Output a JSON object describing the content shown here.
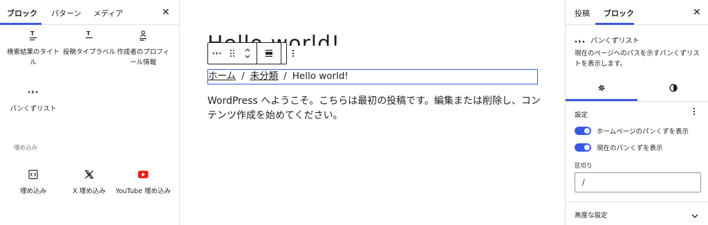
{
  "inserter": {
    "tabs": [
      "ブロック",
      "パターン",
      "メディア"
    ],
    "blocks": [
      {
        "label": "検索結果のタイトル",
        "icon": "title-icon"
      },
      {
        "label": "投稿タイプラベル",
        "icon": "post-type-label-icon"
      },
      {
        "label": "作成者のプロフィール情報",
        "icon": "author-biography-icon"
      },
      {
        "label": "パンくずリスト",
        "icon": "breadcrumbs-icon"
      }
    ],
    "embed_section_title": "埋め込み",
    "embeds": [
      {
        "label": "埋め込み",
        "icon": "embed-icon"
      },
      {
        "label": "X 埋め込み",
        "icon": "x-logo-icon"
      },
      {
        "label": "YouTube 埋め込み",
        "icon": "youtube-icon"
      }
    ]
  },
  "canvas": {
    "ghost_title": "Hello world!",
    "breadcrumbs": [
      {
        "text": "ホーム",
        "link": true
      },
      {
        "text": "未分類",
        "link": true
      },
      {
        "text": "Hello world!",
        "link": false
      }
    ],
    "separator": "/",
    "paragraph": "WordPress へようこそ。こちらは最初の投稿です。編集または削除し、コンテンツ作成を始めてください。"
  },
  "sidebar": {
    "tabs": [
      "投稿",
      "ブロック"
    ],
    "block_name": "パンくずリスト",
    "block_description": "現在のページへのパスを示すパンくずリストを表示します。",
    "settings_title": "設定",
    "toggles": [
      {
        "label": "ホームページのパンくずを表示",
        "on": true
      },
      {
        "label": "現在のパンくずを表示",
        "on": true
      }
    ],
    "separator_label": "区切り",
    "separator_value": "/",
    "advanced_label": "高度な設定"
  },
  "colors": {
    "accent": "#3858e9",
    "youtube": "#e62117",
    "border": "#e0e0e0",
    "text": "#1e1e1e"
  }
}
